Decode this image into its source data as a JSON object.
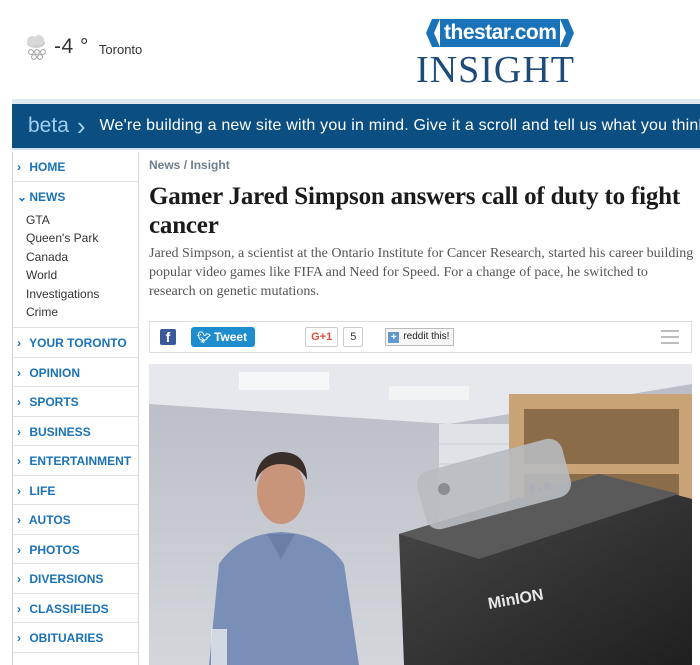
{
  "weather": {
    "temp": "-4 °",
    "city": "Toronto",
    "icon": "snow-cloud-icon"
  },
  "logo": {
    "brand": "thestar.com",
    "section": "INSIGHT",
    "accent": "#1a72b8"
  },
  "beta": {
    "label": "beta",
    "message": "We're building a new site with you in mind. Give it a scroll and tell us what you think."
  },
  "sidebar": {
    "items": [
      {
        "label": "HOME"
      },
      {
        "label": "NEWS"
      },
      {
        "label": "YOUR TORONTO"
      },
      {
        "label": "OPINION"
      },
      {
        "label": "SPORTS"
      },
      {
        "label": "BUSINESS"
      },
      {
        "label": "ENTERTAINMENT"
      },
      {
        "label": "LIFE"
      },
      {
        "label": "AUTOS"
      },
      {
        "label": "PHOTOS"
      },
      {
        "label": "DIVERSIONS"
      },
      {
        "label": "CLASSIFIEDS"
      },
      {
        "label": "OBITUARIES"
      }
    ],
    "news_sub": [
      "GTA",
      "Queen's Park",
      "Canada",
      "World",
      "Investigations",
      "Crime"
    ]
  },
  "article": {
    "breadcrumb": [
      "News",
      "Insight"
    ],
    "headline": "Gamer Jared Simpson answers call of duty to fight cancer",
    "deck": "Jared Simpson, a scientist at the Ontario Institute for Cancer Research, started his career building popular video games like FIFA and Need for Speed. For a change of pace, he switched to research on genetic mutations."
  },
  "share": {
    "facebook": "f",
    "tweet": "Tweet",
    "gplus": "G+1",
    "gplus_count": "5",
    "reddit": "reddit this!"
  },
  "photo": {
    "device_label": "MinION"
  }
}
